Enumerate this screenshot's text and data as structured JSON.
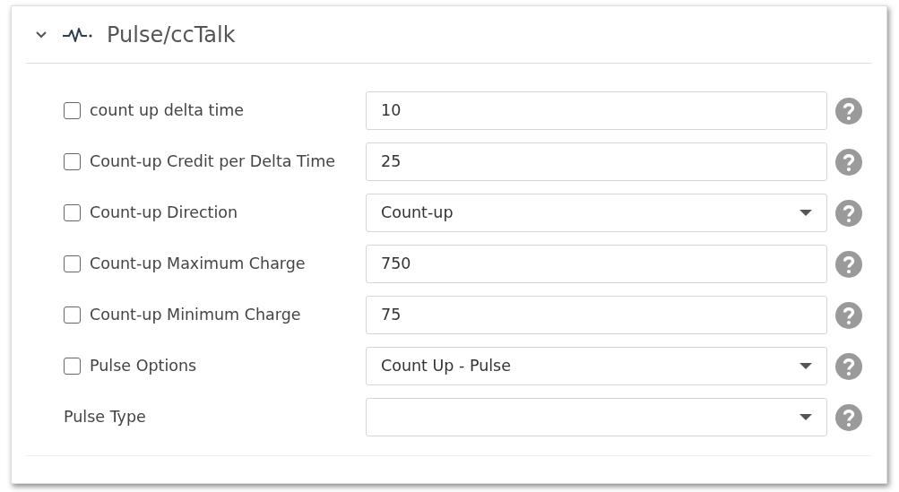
{
  "section": {
    "title": "Pulse/ccTalk",
    "expanded": true
  },
  "fields": [
    {
      "label": "count up delta time",
      "checked": false,
      "kind": "text",
      "value": "10"
    },
    {
      "label": "Count-up Credit per Delta Time",
      "checked": false,
      "kind": "text",
      "value": "25"
    },
    {
      "label": "Count-up Direction",
      "checked": false,
      "kind": "select",
      "value": "Count-up"
    },
    {
      "label": "Count-up Maximum Charge",
      "checked": false,
      "kind": "text",
      "value": "750"
    },
    {
      "label": "Count-up Minimum Charge",
      "checked": false,
      "kind": "text",
      "value": "75"
    },
    {
      "label": "Pulse Options",
      "checked": false,
      "kind": "select",
      "value": "Count Up - Pulse"
    },
    {
      "label": "Pulse Type",
      "kind": "select"
    }
  ]
}
